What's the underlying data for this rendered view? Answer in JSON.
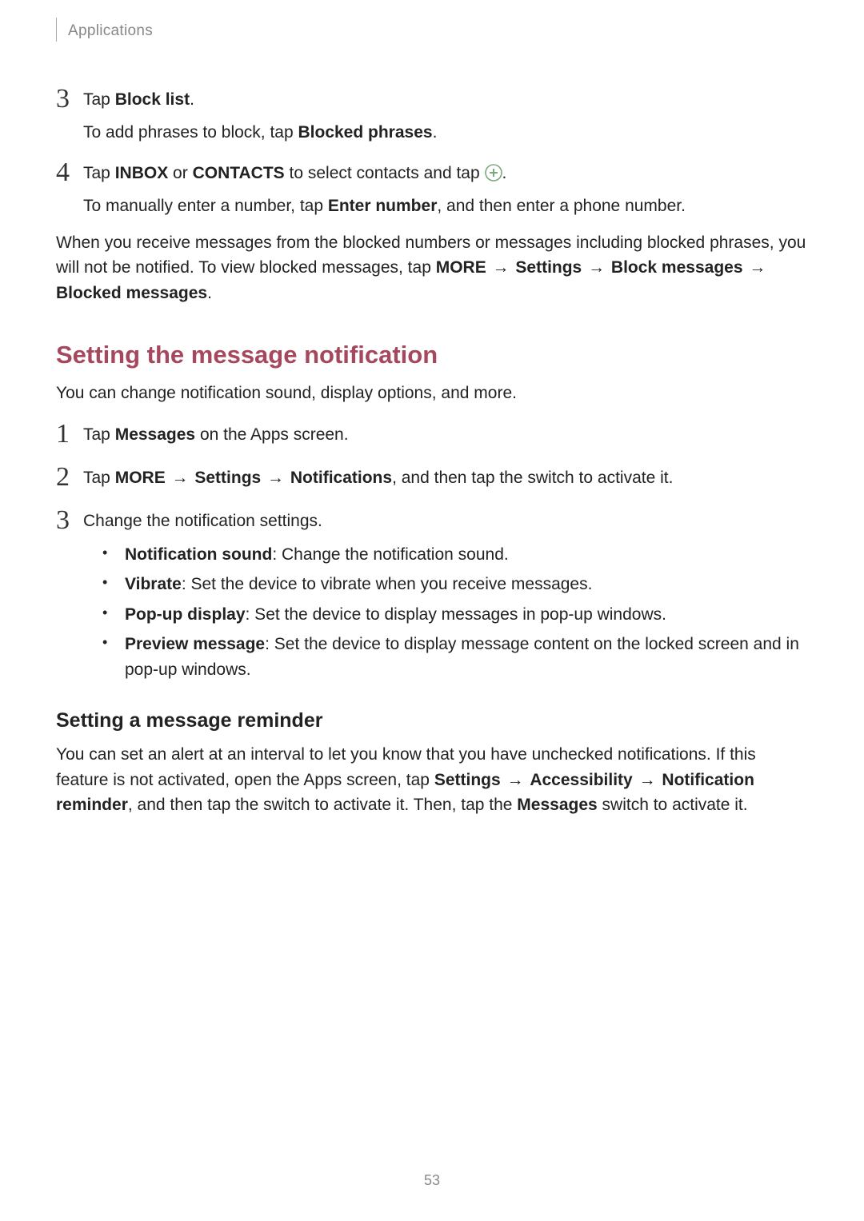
{
  "header": "Applications",
  "step3": {
    "num": "3",
    "text_pre": "Tap ",
    "text_bold": "Block list",
    "text_post": ".",
    "sub_pre": "To add phrases to block, tap ",
    "sub_bold": "Blocked phrases",
    "sub_post": "."
  },
  "step4": {
    "num": "4",
    "pre": "Tap ",
    "b1": "INBOX",
    "mid1": " or ",
    "b2": "CONTACTS",
    "mid2": " to select contacts and tap ",
    "post": ".",
    "sub_pre": "To manually enter a number, tap ",
    "sub_b": "Enter number",
    "sub_post": ", and then enter a phone number."
  },
  "para1": {
    "t1": "When you receive messages from the blocked numbers or messages including blocked phrases, you will not be notified. To view blocked messages, tap ",
    "b1": "MORE",
    "a1": " → ",
    "b2": "Settings",
    "a2": " → ",
    "b3": "Block messages",
    "a3": " → ",
    "b4": "Blocked messages",
    "t2": "."
  },
  "h2": "Setting the message notification",
  "h2_intro": "You can change notification sound, display options, and more.",
  "n1": {
    "num": "1",
    "pre": "Tap ",
    "b": "Messages",
    "post": " on the Apps screen."
  },
  "n2": {
    "num": "2",
    "pre": "Tap ",
    "b1": "MORE",
    "a1": " → ",
    "b2": "Settings",
    "a2": " → ",
    "b3": "Notifications",
    "post": ", and then tap the switch to activate it."
  },
  "n3": {
    "num": "3",
    "text": "Change the notification settings."
  },
  "bullets": {
    "b1_b": "Notification sound",
    "b1_t": ": Change the notification sound.",
    "b2_b": "Vibrate",
    "b2_t": ": Set the device to vibrate when you receive messages.",
    "b3_b": "Pop-up display",
    "b3_t": ": Set the device to display messages in pop-up windows.",
    "b4_b": "Preview message",
    "b4_t": ": Set the device to display message content on the locked screen and in pop-up windows."
  },
  "h3": "Setting a message reminder",
  "para2": {
    "t1": "You can set an alert at an interval to let you know that you have unchecked notifications. If this feature is not activated, open the Apps screen, tap ",
    "b1": "Settings",
    "a1": " → ",
    "b2": "Accessibility",
    "a2": " → ",
    "b3": "Notification reminder",
    "t2": ", and then tap the switch to activate it. Then, tap the ",
    "b4": "Messages",
    "t3": " switch to activate it."
  },
  "pagenum": "53"
}
